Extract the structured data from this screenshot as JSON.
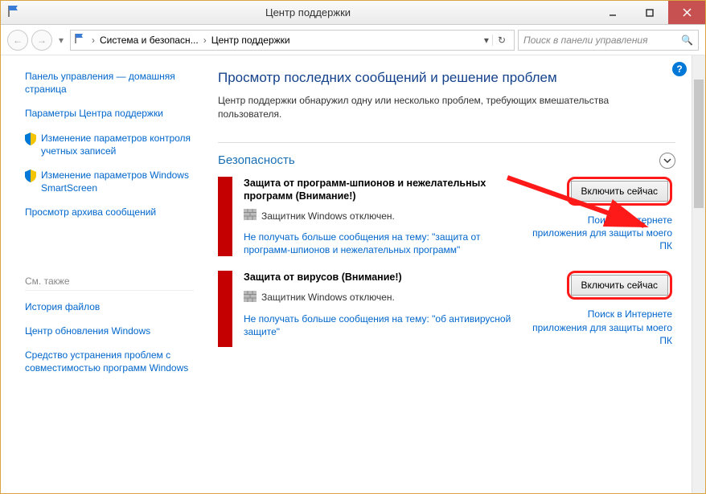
{
  "window": {
    "title": "Центр поддержки"
  },
  "breadcrumb": {
    "item1": "Система и безопасн...",
    "item2": "Центр поддержки"
  },
  "search": {
    "placeholder": "Поиск в панели управления"
  },
  "sidebar": {
    "links": [
      "Панель управления — домашняя страница",
      "Параметры Центра поддержки",
      "Изменение параметров контроля учетных записей",
      "Изменение параметров Windows SmartScreen",
      "Просмотр архива сообщений"
    ],
    "seeAlsoLabel": "См. также",
    "seeAlso": [
      "История файлов",
      "Центр обновления Windows",
      "Средство устранения проблем с совместимостью программ Windows"
    ]
  },
  "main": {
    "heading": "Просмотр последних сообщений и решение проблем",
    "subtext": "Центр поддержки обнаружил одну или несколько проблем, требующих вмешательства пользователя.",
    "sectionLabel": "Безопасность",
    "cards": [
      {
        "title": "Защита от программ-шпионов и нежелательных программ (Внимание!)",
        "status": "Защитник Windows отключен.",
        "dismissLink": "Не получать больше сообщения на тему: \"защита от программ-шпионов и нежелательных программ\"",
        "actionBtn": "Включить сейчас",
        "rightLink": "Поиск в Интернете приложения для защиты моего ПК"
      },
      {
        "title": "Защита от вирусов (Внимание!)",
        "status": "Защитник Windows отключен.",
        "dismissLink": "Не получать больше сообщения на тему: \"об антивирусной защите\"",
        "actionBtn": "Включить сейчас",
        "rightLink": "Поиск в Интернете приложения для защиты моего ПК"
      }
    ]
  }
}
